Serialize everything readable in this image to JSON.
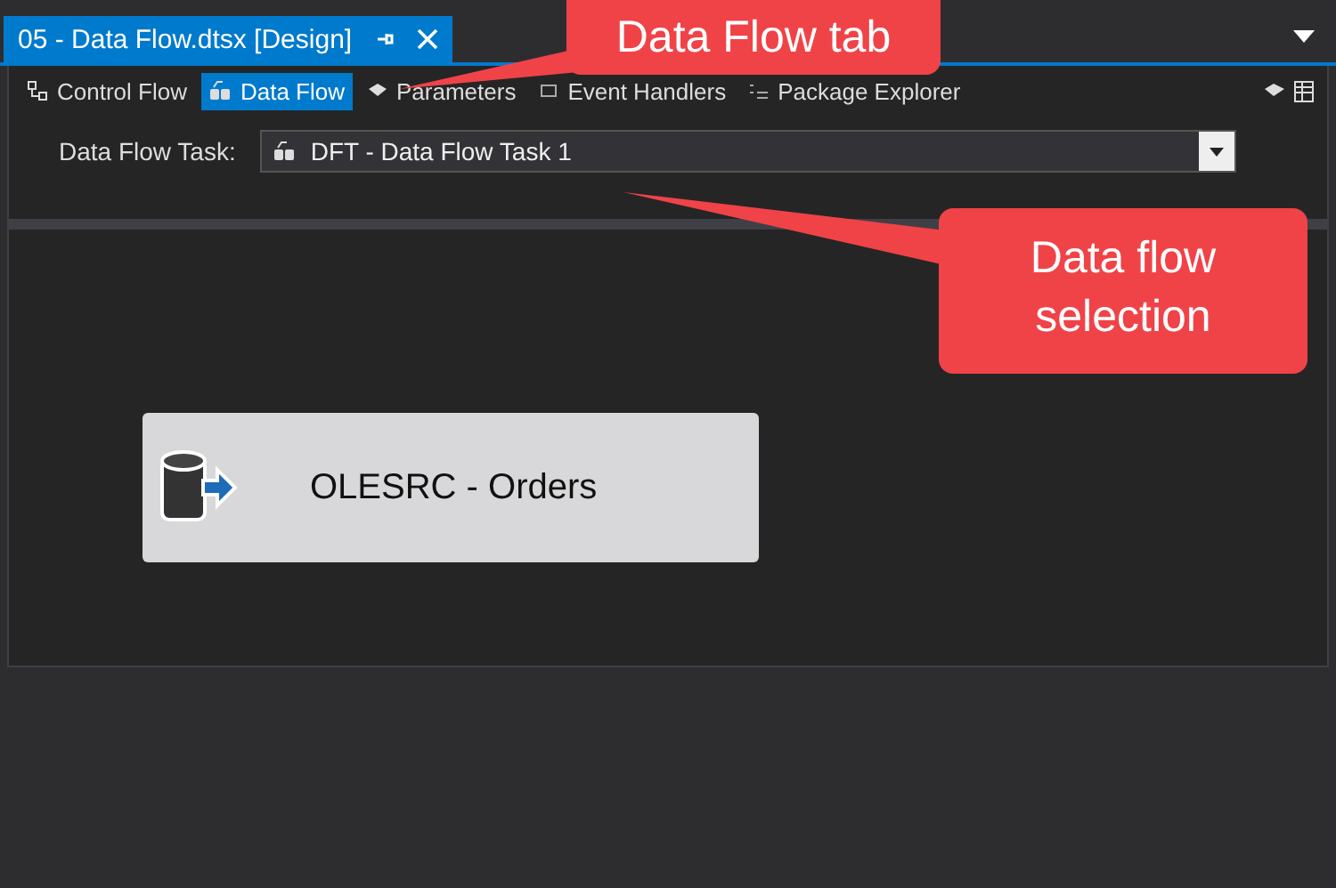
{
  "document_tab": {
    "title": "05 - Data Flow.dtsx [Design]",
    "selected": true
  },
  "designer_tabs": [
    {
      "label": "Control Flow",
      "selected": false,
      "kind": "control"
    },
    {
      "label": "Data Flow",
      "selected": true,
      "kind": "data"
    },
    {
      "label": "Parameters",
      "selected": false,
      "kind": "params"
    },
    {
      "label": "Event Handlers",
      "selected": false,
      "kind": "events"
    },
    {
      "label": "Package Explorer",
      "selected": false,
      "kind": "explorer"
    }
  ],
  "task_field": {
    "label": "Data Flow Task:",
    "value": "DFT - Data Flow Task 1"
  },
  "components": [
    {
      "label": "OLESRC - Orders"
    }
  ],
  "callouts": [
    {
      "text": "Data Flow tab"
    },
    {
      "text": "Data flow selection"
    }
  ]
}
